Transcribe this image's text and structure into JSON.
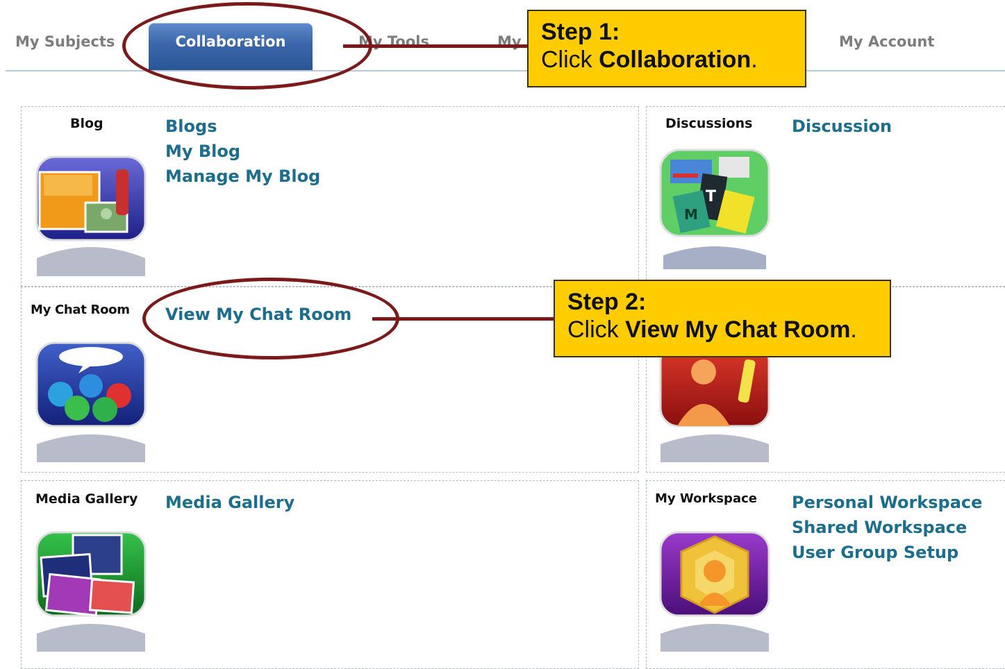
{
  "tabs": [
    {
      "label": "My Subjects"
    },
    {
      "label": "Collaboration",
      "active": true
    },
    {
      "label": "My Tools"
    },
    {
      "label": "My"
    },
    {
      "label": "My Account"
    }
  ],
  "panels": {
    "blog": {
      "title": "Blog",
      "icon": "blog-icon",
      "links": [
        "Blogs",
        "My Blog",
        "Manage My Blog"
      ]
    },
    "discussions": {
      "title": "Discussions",
      "icon": "discussions-icon",
      "links": [
        "Discussion"
      ]
    },
    "chat": {
      "title": "My Chat Room",
      "icon": "chat-room-icon",
      "links": [
        "View My Chat Room"
      ]
    },
    "profile": {
      "icon": "profile-icon"
    },
    "media": {
      "title": "Media Gallery",
      "icon": "media-gallery-icon",
      "links": [
        "Media Gallery"
      ]
    },
    "workspace": {
      "title": "My Workspace",
      "icon": "workspace-icon",
      "links": [
        "Personal Workspace",
        "Shared Workspace",
        "User Group Setup"
      ]
    }
  },
  "callouts": {
    "step1": {
      "step": "Step 1:",
      "prefix": "Click ",
      "target": "Collaboration",
      "suffix": "."
    },
    "step2": {
      "step": "Step 2:",
      "prefix": "Click ",
      "target": "View My Chat Room",
      "suffix": "."
    }
  },
  "colors": {
    "link": "#1c6e8c",
    "tab_active": "#3b67aa",
    "callout_bg": "#ffcc00",
    "annotation": "#7b1a1a"
  }
}
